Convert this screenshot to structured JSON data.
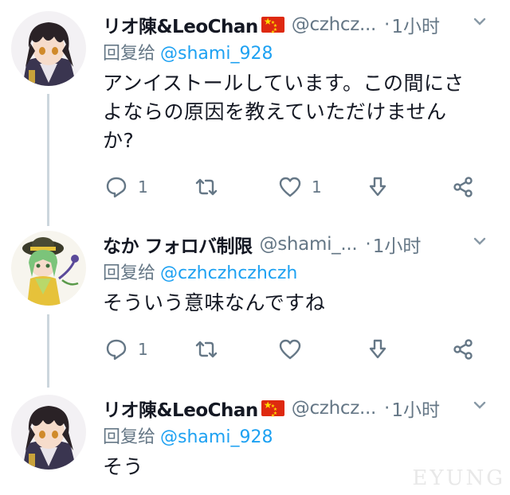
{
  "tweets": [
    {
      "name": "リオ陳&LeoChan",
      "has_flag": true,
      "handle": "@czhcz...",
      "separator": "·",
      "time": "1小时",
      "reply_label": "回复给",
      "reply_to": "@shami_928",
      "text_lines": [
        "アンイストールしています。この間にさ",
        "よならの原因を教えていただけません",
        "か?"
      ],
      "reply_count": "1",
      "retweet_count": "",
      "like_count": "1"
    },
    {
      "name": "なか フォロバ制限",
      "has_flag": false,
      "handle": "@shami_...",
      "separator": "·",
      "time": "1小时",
      "reply_label": "回复给",
      "reply_to": "@czhczhczhczh",
      "text_lines": [
        "そういう意味なんですね"
      ],
      "reply_count": "1",
      "retweet_count": "",
      "like_count": ""
    },
    {
      "name": "リオ陳&LeoChan",
      "has_flag": true,
      "handle": "@czhcz...",
      "separator": "·",
      "time": "1小时",
      "reply_label": "回复给",
      "reply_to": "@shami_928",
      "text_lines": [
        "そう"
      ]
    }
  ],
  "icons": {
    "reply": "speech-bubble-icon",
    "retweet": "retweet-arrows-icon",
    "like": "heart-icon",
    "download": "download-arrow-icon",
    "share": "share-nodes-icon",
    "more": "chevron-down-icon",
    "flag": "china-flag-icon"
  },
  "colors": {
    "text": "#141823",
    "secondary": "#657786",
    "link": "#1da1f2",
    "thread_line": "#ccd6dd",
    "flag_red": "#de2910",
    "flag_yellow": "#ffde00"
  },
  "watermark": "EYUNG"
}
